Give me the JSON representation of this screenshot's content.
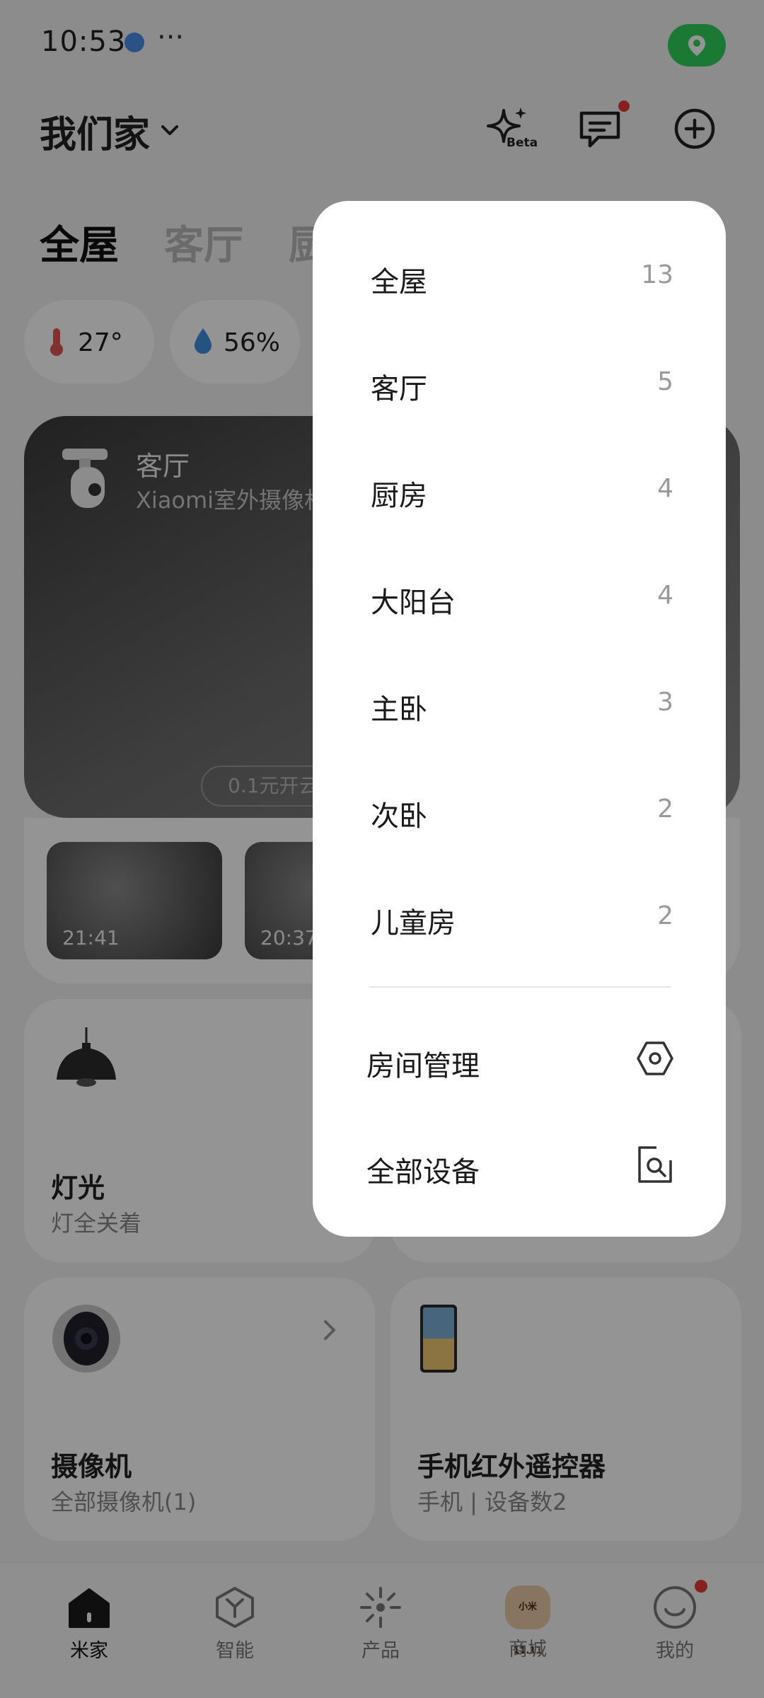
{
  "status_bar": {
    "time": "10:53",
    "more": "···"
  },
  "header": {
    "home_name": "我们家",
    "beta_label": "Beta"
  },
  "tabs": [
    "全屋",
    "客厅",
    "厨"
  ],
  "env": {
    "temperature": "27°",
    "humidity": "56%"
  },
  "camera_card": {
    "room": "客厅",
    "device": "Xiaomi室外摄像机",
    "promo": "0.1元开云",
    "thumbs": [
      {
        "time": "21:41"
      },
      {
        "time": "20:37"
      }
    ]
  },
  "devices": {
    "light": {
      "title": "灯光",
      "subtitle": "灯全关着"
    },
    "camera": {
      "title": "摄像机",
      "subtitle": "全部摄像机(1)"
    },
    "ir": {
      "title": "手机红外遥控器",
      "subtitle": "手机 | 设备数2"
    }
  },
  "room_menu": {
    "rooms": [
      {
        "name": "全屋",
        "count": "13"
      },
      {
        "name": "客厅",
        "count": "5"
      },
      {
        "name": "厨房",
        "count": "4"
      },
      {
        "name": "大阳台",
        "count": "4"
      },
      {
        "name": "主卧",
        "count": "3"
      },
      {
        "name": "次卧",
        "count": "2"
      },
      {
        "name": "儿童房",
        "count": "2"
      }
    ],
    "actions": [
      {
        "label": "房间管理",
        "icon": "settings-hexagon-icon"
      },
      {
        "label": "全部设备",
        "icon": "search-device-icon"
      }
    ]
  },
  "bottom_nav": [
    {
      "label": "米家",
      "icon": "home-icon"
    },
    {
      "label": "智能",
      "icon": "smart-cube-icon"
    },
    {
      "label": "产品",
      "icon": "product-spark-icon"
    },
    {
      "label": "商城",
      "icon": "mall-badge-icon",
      "badge": "小米11.11"
    },
    {
      "label": "我的",
      "icon": "profile-smile-icon"
    }
  ],
  "colors": {
    "accent_green": "#2fcf5c",
    "notify_red": "#e53935"
  }
}
